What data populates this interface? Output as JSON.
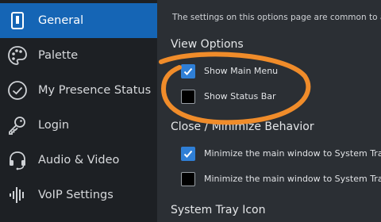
{
  "sidebar": {
    "items": [
      {
        "label": "General",
        "icon": "general-icon",
        "active": true
      },
      {
        "label": "Palette",
        "icon": "palette-icon"
      },
      {
        "label": "My Presence Status",
        "icon": "check-circle-icon"
      },
      {
        "label": "Login",
        "icon": "key-icon"
      },
      {
        "label": "Audio & Video",
        "icon": "headset-icon"
      },
      {
        "label": "VoIP Settings",
        "icon": "waveform-icon"
      }
    ]
  },
  "main": {
    "intro": "The settings on this options page are common to a",
    "sections": {
      "view_options": "View Options",
      "close_minimize": "Close / Minimize Behavior",
      "system_tray": "System Tray Icon"
    },
    "checkboxes": {
      "show_main_menu": {
        "label": "Show Main Menu",
        "checked": true
      },
      "show_status_bar": {
        "label": "Show Status Bar",
        "checked": false
      },
      "minimize_1": {
        "label": "Minimize the main window to System Tray",
        "checked": true
      },
      "minimize_2": {
        "label": "Minimize the main window to System Tray",
        "checked": false
      }
    }
  },
  "colors": {
    "accent": "#1565b5",
    "checkbox": "#2f7fd6",
    "highlight_oval": "#f08c2a"
  }
}
